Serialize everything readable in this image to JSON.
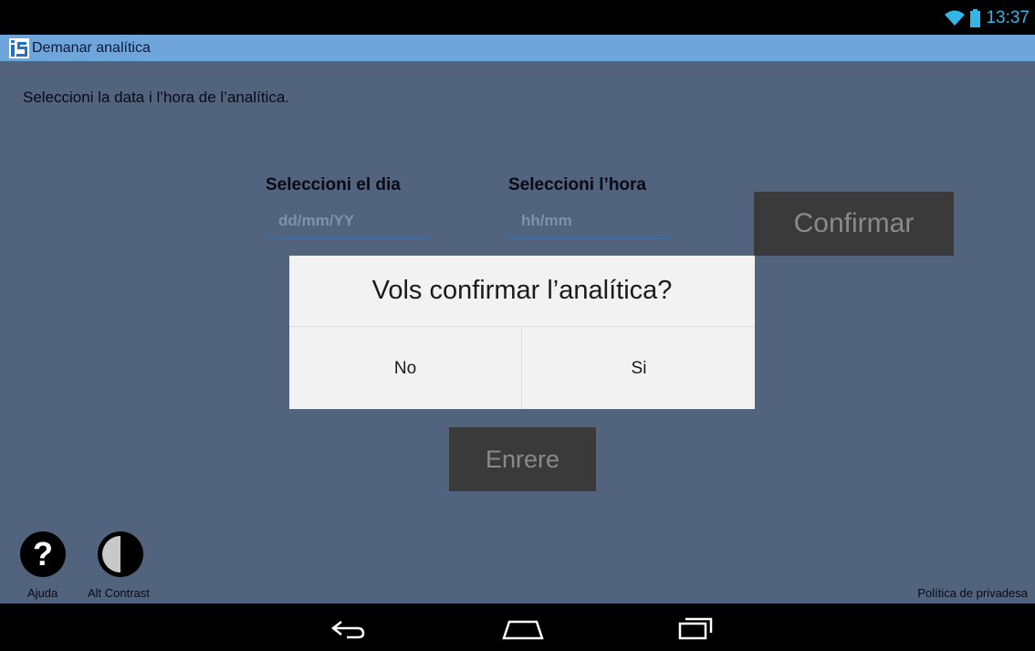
{
  "status_bar": {
    "time": "13:37",
    "accent_color": "#33b5e5",
    "wifi_icon": "wifi-icon",
    "battery_icon": "battery-icon"
  },
  "action_bar": {
    "app_icon": "app-logo-icon",
    "title": "Demanar analítica",
    "background": "#6ea6dc"
  },
  "main": {
    "instruction": "Seleccioni la data i l’hora de l’analítica.",
    "day_label": "Seleccioni el dia",
    "day_placeholder": "dd/mm/YY",
    "hour_label": "Seleccioni l’hora",
    "hour_placeholder": "hh/mm",
    "confirm_label": "Confirmar",
    "back_label": "Enrere",
    "background": "#52637d"
  },
  "dialog": {
    "title": "Vols confirmar l’analítica?",
    "no_label": "No",
    "yes_label": "Si"
  },
  "footer": {
    "help_label": "Ajuda",
    "help_icon": "help-icon",
    "contrast_label": "Alt Contrast",
    "contrast_icon": "contrast-icon",
    "privacy_label": "Política de privadesa"
  },
  "nav_bar": {
    "back_icon": "back-icon",
    "home_icon": "home-icon",
    "recents_icon": "recents-icon"
  }
}
